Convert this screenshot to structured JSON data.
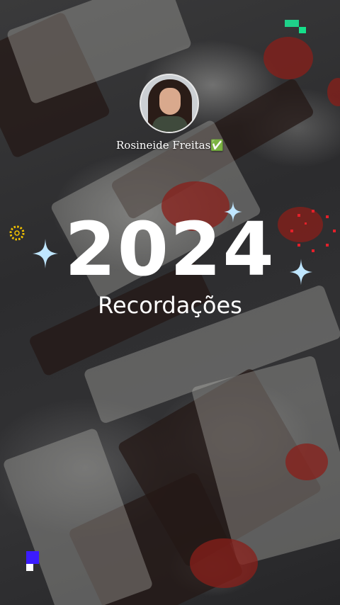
{
  "profile": {
    "name": "Rosineide Freitas✅"
  },
  "story": {
    "year": "2024",
    "subtitle": "Recordações"
  },
  "colors": {
    "text": "#ffffff",
    "sparkle": "#bfe6ff",
    "accent_green": "#1fd18a",
    "accent_blue": "#3b1cff",
    "dots_red": "#e3202a",
    "ring_yellow": "#f2c200"
  },
  "icons": [
    "sparkle-icon",
    "dotted-ring-icon",
    "dotted-circle-icon",
    "pixel-block-icon"
  ]
}
